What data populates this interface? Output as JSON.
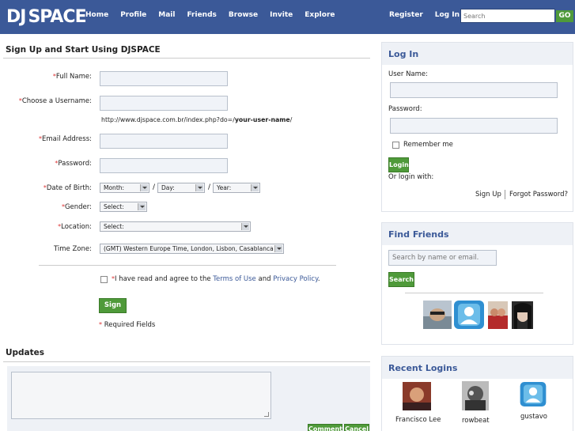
{
  "header": {
    "logo_dj": "DJ",
    "logo_space": "SPACE",
    "nav": [
      "Home",
      "Profile",
      "Mail",
      "Friends",
      "Browse",
      "Invite",
      "Explore"
    ],
    "register": "Register",
    "login": "Log In",
    "search_placeholder": "Search",
    "go": "GO"
  },
  "signup": {
    "title": "Sign Up and Start Using DJSPACE",
    "req_mark": "*",
    "full_name": "Full Name:",
    "username": "Choose a Username:",
    "url_prefix": "http://www.djspace.com.br/index.php?do=/",
    "url_bold": "your-user-name",
    "url_suffix": "/",
    "email": "Email Address:",
    "password": "Password:",
    "dob": "Date of Birth:",
    "month": "Month:",
    "day": "Day:",
    "year": "Year:",
    "slash": "/",
    "gender": "Gender:",
    "gender_value": "Select:",
    "location": "Location:",
    "location_value": "Select:",
    "timezone": "Time Zone:",
    "timezone_value": "(GMT) Western Europe Time, London, Lisbon, Casablanca",
    "agree_prefix": "I have read and agree to the ",
    "terms": "Terms of Use",
    "and": " and ",
    "privacy": "Privacy Policy",
    "period": ".",
    "signup_button": "Sign Up",
    "required_fields": "Required Fields"
  },
  "updates": {
    "title": "Updates",
    "comment_button": "Comment",
    "cancel_button": "Cancel"
  },
  "login_panel": {
    "title": "Log In",
    "username": "User Name:",
    "password": "Password:",
    "remember": "Remember me",
    "login_button": "Login",
    "or_login": "Or login with:",
    "signup_link": "Sign Up",
    "forgot_link": "Forgot Password?"
  },
  "find_friends": {
    "title": "Find Friends",
    "placeholder": "Search by name or email.",
    "search_button": "Search"
  },
  "recent_logins": {
    "title": "Recent Logins",
    "users": [
      "Francisco Lee",
      "rowbeat",
      "gustavo"
    ]
  }
}
